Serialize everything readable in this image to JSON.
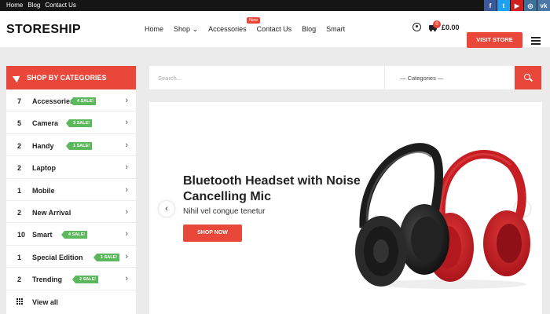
{
  "topbar": {
    "links": [
      "Home",
      "Blog",
      "Contact Us"
    ],
    "social": [
      {
        "icon": "facebook-icon",
        "glyph": "f",
        "color": "#3b5998"
      },
      {
        "icon": "twitter-icon",
        "glyph": "t",
        "color": "#1da1f2"
      },
      {
        "icon": "youtube-icon",
        "glyph": "▶",
        "color": "#cd201f"
      },
      {
        "icon": "instagram-icon",
        "glyph": "◎",
        "color": "#3f729b"
      },
      {
        "icon": "vk-icon",
        "glyph": "vk",
        "color": "#4a76a8"
      }
    ]
  },
  "header": {
    "logo": "STORESHIP",
    "nav": [
      "Home",
      "Shop",
      "Accessories",
      "Contact Us",
      "Blog",
      "Smart"
    ],
    "shop_caret": "⌄",
    "new_badge": "New",
    "cart_count": "0",
    "cart_total": "£0.00",
    "visit_store": "VISIT STORE"
  },
  "sidebar": {
    "title": "SHOP BY CATEGORIES",
    "categories": [
      {
        "count": "7",
        "name": "Accessories",
        "sale": "4 SALE!"
      },
      {
        "count": "5",
        "name": "Camera",
        "sale": "3 SALE!"
      },
      {
        "count": "2",
        "name": "Handy",
        "sale": "1 SALE!"
      },
      {
        "count": "2",
        "name": "Laptop",
        "sale": ""
      },
      {
        "count": "1",
        "name": "Mobile",
        "sale": ""
      },
      {
        "count": "2",
        "name": "New Arrival",
        "sale": ""
      },
      {
        "count": "10",
        "name": "Smart",
        "sale": "4 SALE!"
      },
      {
        "count": "1",
        "name": "Special Edition",
        "sale": "1 SALE!"
      },
      {
        "count": "2",
        "name": "Trending",
        "sale": "2 SALE!"
      }
    ],
    "view_all": "View all"
  },
  "search": {
    "placeholder": "Search...",
    "category_select": "— Categories —"
  },
  "hero": {
    "title": "Bluetooth Headset with Noise Cancelling Mic",
    "subtitle": "Nihil vel congue tenetur",
    "button": "SHOP NOW",
    "prev": "‹",
    "next": "›"
  },
  "colors": {
    "accent": "#e8473a",
    "sale": "#5cb85c",
    "topbar": "#151515"
  }
}
